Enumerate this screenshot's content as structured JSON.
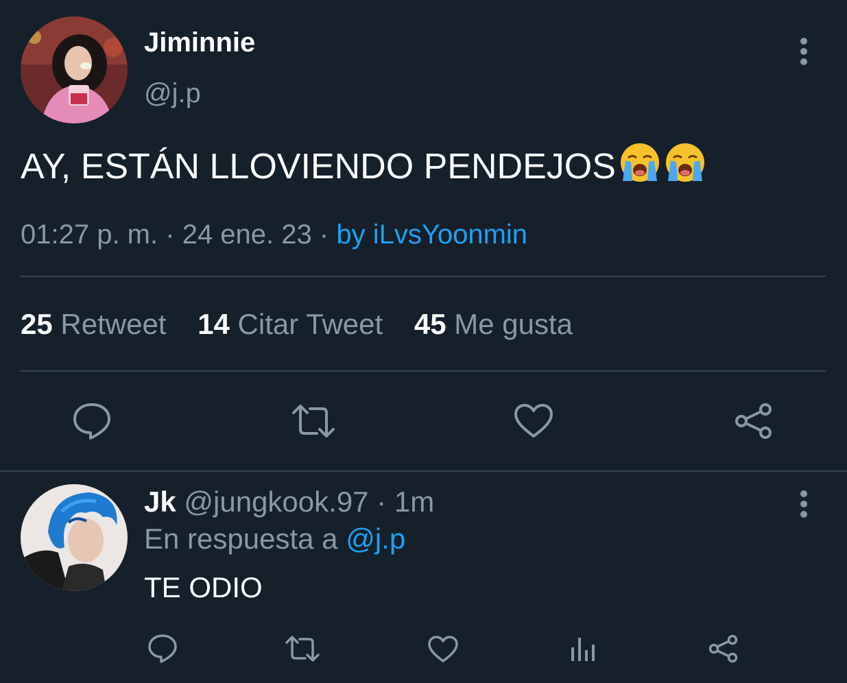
{
  "tweet": {
    "display_name": "Jiminnie",
    "handle": "@j.p",
    "text": "AY, ESTÁN LLOVIENDO PENDEJOS",
    "emoji": [
      "loudly-crying-face",
      "loudly-crying-face"
    ],
    "time": "01:27 p. m.",
    "date": "24 ene. 23",
    "client": "by iLvsYoonmin",
    "stats": {
      "retweets_count": "25",
      "retweets_label": "Retweet",
      "quotes_count": "14",
      "quotes_label": "Citar Tweet",
      "likes_count": "45",
      "likes_label": "Me gusta"
    }
  },
  "reply": {
    "display_name": "Jk",
    "handle": "@jungkook.97",
    "time": "1m",
    "reply_prefix": "En respuesta a",
    "reply_mention": "@j.p",
    "text": "TE ODIO"
  },
  "colors": {
    "background": "#15202b",
    "secondary_text": "#8899a6",
    "accent": "#1da1f2",
    "divider": "#38444d"
  },
  "icons": {
    "more": "more-vertical-icon",
    "reply": "comment-icon",
    "retweet": "retweet-icon",
    "like": "heart-icon",
    "share": "share-icon",
    "analytics": "analytics-icon"
  }
}
